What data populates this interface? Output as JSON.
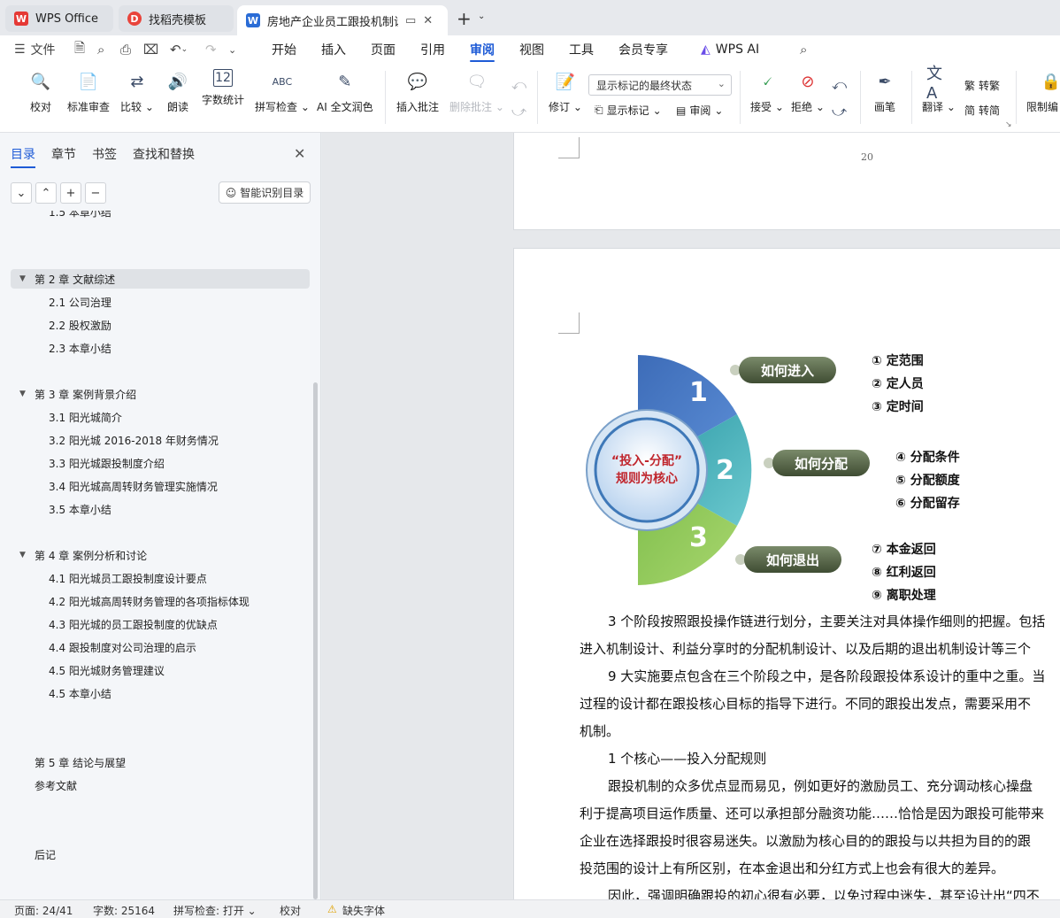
{
  "tabs": [
    {
      "label": "WPS Office",
      "icon": "wps-logo"
    },
    {
      "label": "找稻壳模板",
      "icon": "docer-logo"
    },
    {
      "label": "房地产企业员工跟投机制设计",
      "icon": "word-logo"
    }
  ],
  "menu": {
    "file": "文件",
    "items": [
      "开始",
      "插入",
      "页面",
      "引用",
      "审阅",
      "视图",
      "工具",
      "会员专享"
    ],
    "selected": "审阅",
    "wps_ai": "WPS AI"
  },
  "ribbon": {
    "proofread": "校对",
    "standard_review": "标准审查",
    "compare": "比较",
    "read_aloud": "朗读",
    "word_count": "字数统计",
    "spell_check": "拼写检查",
    "ai_polish": "AI 全文润色",
    "insert_comment": "插入批注",
    "delete_comment": "删除批注",
    "track_changes": "修订",
    "markup_state": "显示标记的最终状态",
    "show_markup": "显示标记",
    "review_pane": "审阅",
    "accept": "接受",
    "reject": "拒绝",
    "ink": "画笔",
    "translate": "翻译",
    "to_traditional": "转繁",
    "to_simplified": "转简",
    "restrict_edit": "限制编"
  },
  "sidebar": {
    "tabs": [
      "目录",
      "章节",
      "书签",
      "查找和替换"
    ],
    "smart_toc": "智能识别目录",
    "toc": [
      {
        "label": "1.5  本章小结",
        "level": 2
      },
      {
        "label": "第 2 章  文献综述",
        "level": 1,
        "selected": true
      },
      {
        "label": "2.1  公司治理",
        "level": 2
      },
      {
        "label": "2.2  股权激励",
        "level": 2
      },
      {
        "label": "2.3  本章小结",
        "level": 2
      },
      {
        "label": "第 3 章  案例背景介绍",
        "level": 1
      },
      {
        "label": "3.1  阳光城简介",
        "level": 2
      },
      {
        "label": "3.2  阳光城 2016-2018 年财务情况",
        "level": 2
      },
      {
        "label": "3.3  阳光城跟投制度介绍",
        "level": 2
      },
      {
        "label": "3.4  阳光城高周转财务管理实施情况",
        "level": 2
      },
      {
        "label": "3.5  本章小结",
        "level": 2
      },
      {
        "label": "第 4 章  案例分析和讨论",
        "level": 1
      },
      {
        "label": "4.1  阳光城员工跟投制度设计要点",
        "level": 2
      },
      {
        "label": "4.2  阳光城高周转财务管理的各项指标体现",
        "level": 2
      },
      {
        "label": "4.3  阳光城的员工跟投制度的优缺点",
        "level": 2
      },
      {
        "label": "4.4  跟投制度对公司治理的启示",
        "level": 2
      },
      {
        "label": "4.5  阳光城财务管理建议",
        "level": 2
      },
      {
        "label": "4.5  本章小结",
        "level": 2
      },
      {
        "label": "第 5 章  结论与展望",
        "level": 1
      },
      {
        "label": "参考文献",
        "level": 1
      },
      {
        "label": "后记",
        "level": 1
      }
    ]
  },
  "document": {
    "page_number": "20",
    "figure": {
      "center_text": [
        "“投入-分配”",
        "规则为核心"
      ],
      "stages": [
        {
          "number": "1",
          "label": "如何进入",
          "items": [
            "① 定范围",
            "② 定人员",
            "③ 定时间"
          ]
        },
        {
          "number": "2",
          "label": "如何分配",
          "items": [
            "④ 分配条件",
            "⑤ 分配额度",
            "⑥ 分配留存"
          ]
        },
        {
          "number": "3",
          "label": "如何退出",
          "items": [
            "⑦ 本金返回",
            "⑧ 红利返回",
            "⑨ 离职处理"
          ]
        }
      ]
    },
    "paragraphs": [
      "3 个阶段按照跟投操作链进行划分，主要关注对具体操作细则的把握。包括",
      "进入机制设计、利益分享时的分配机制设计、以及后期的退出机制设计等三个",
      "9 大实施要点包含在三个阶段之中，是各阶段跟投体系设计的重中之重。当",
      "过程的设计都在跟投核心目标的指导下进行。不同的跟投出发点，需要采用不",
      "机制。",
      "1 个核心——投入分配规则",
      "跟投机制的众多优点显而易见，例如更好的激励员工、充分调动核心操盘",
      "利于提高项目运作质量、还可以承担部分融资功能……恰恰是因为跟投可能带来",
      "企业在选择跟投时很容易迷失。以激励为核心目的的跟投与以共担为目的的跟",
      "投范围的设计上有所区别，在本金退出和分红方式上也会有很大的差异。",
      "因此，强调明确跟投的初心很有必要，以免过程中迷失，甚至设计出“四不"
    ]
  },
  "status": {
    "page": "页面: 24/41",
    "words": "字数: 25164",
    "spell": "拼写检查: 打开",
    "proof": "校对",
    "missing_font": "缺失字体"
  }
}
